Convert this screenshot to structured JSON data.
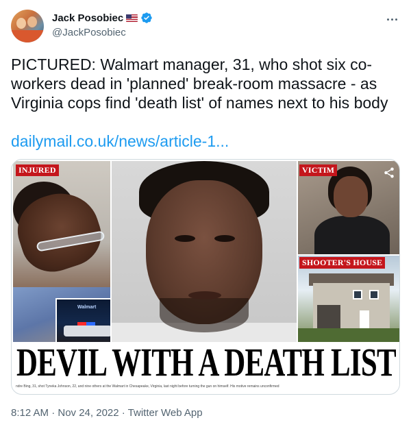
{
  "author": {
    "display_name": "Jack Posobiec",
    "handle": "@JackPosobiec",
    "flag_icon": "us-flag-icon",
    "verified_icon": "verified-badge-icon"
  },
  "tweet": {
    "text": "PICTURED: Walmart manager, 31, who shot six co-workers dead in 'planned' break-room massacre - as Virginia cops find 'death list' of names next to his body",
    "link": "dailymail.co.uk/news/article-1..."
  },
  "media": {
    "labels": {
      "injured": "INJURED",
      "victim": "VICTIM",
      "shooters_house": "SHOOTER'S HOUSE"
    },
    "inset_sign": "Walmart",
    "headline": "DEVIL WITH A DEATH LIST",
    "caption": "ndre Bing, 31, shot Tyneka Johnson, 22, and nine others at the Walmart in Chesapeake, Virginia, last night before turning the gun on himself. His motive remains unconfirmed"
  },
  "meta": {
    "timestamp": "8:12 AM · Nov 24, 2022 · Twitter Web App"
  },
  "colors": {
    "link": "#1d9bf0",
    "label_red": "#c4161c",
    "verified_blue": "#1d9bf0",
    "secondary_text": "#536471"
  }
}
